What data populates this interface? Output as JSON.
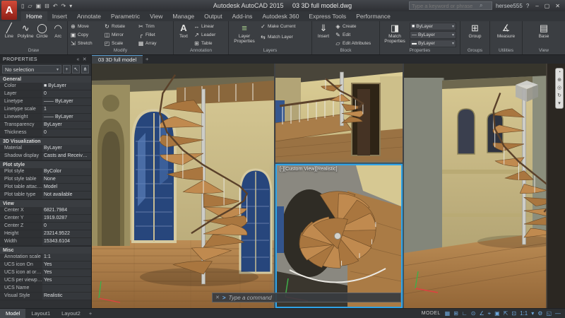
{
  "titlebar": {
    "logo": "A",
    "quick_access": [
      "▯",
      "▱",
      "▣",
      "⊟",
      "↶",
      "↷",
      "▾"
    ],
    "app_title": "Autodesk AutoCAD 2015",
    "doc_title": "03 3D full model.dwg",
    "search_placeholder": "Type a keyword or phrase",
    "search_icon": "⌕",
    "user": "hersee555",
    "help": "?",
    "min": "–",
    "max": "▢",
    "close": "✕"
  },
  "ribbon": {
    "tabs": [
      "Home",
      "Insert",
      "Annotate",
      "Parametric",
      "View",
      "Manage",
      "Output",
      "Add-ins",
      "Autodesk 360",
      "Express Tools",
      "Performance"
    ],
    "panels": {
      "draw": {
        "title": "Draw",
        "items": [
          {
            "icon": "╱",
            "label": "Line"
          },
          {
            "icon": "∿",
            "label": "Polyline"
          },
          {
            "icon": "◯",
            "label": "Circle"
          },
          {
            "icon": "◠",
            "label": "Arc"
          }
        ]
      },
      "modify": {
        "title": "Modify",
        "items": [
          {
            "icon": "⊕",
            "label": "Move"
          },
          {
            "icon": "▣",
            "label": "Copy"
          },
          {
            "icon": "⇲",
            "label": "Stretch"
          },
          {
            "icon": "↻",
            "label": "Rotate"
          },
          {
            "icon": "◫",
            "label": "Mirror"
          },
          {
            "icon": "◰",
            "label": "Scale"
          },
          {
            "icon": "✂",
            "label": "Trim"
          },
          {
            "icon": "╭",
            "label": "Fillet"
          },
          {
            "icon": "▦",
            "label": "Array"
          }
        ]
      },
      "annotation": {
        "title": "Annotation",
        "big": {
          "icon": "A",
          "label": "Text"
        },
        "items": [
          {
            "icon": "↔",
            "label": "Linear"
          },
          {
            "icon": "↗",
            "label": "Leader"
          },
          {
            "icon": "⊞",
            "label": "Table"
          }
        ]
      },
      "layers": {
        "title": "Layers",
        "big": {
          "icon": "≡",
          "label": "Layer Properties"
        },
        "items": [
          {
            "icon": "✓",
            "label": "Make Current"
          },
          {
            "icon": "⇆",
            "label": "Match Layer"
          }
        ]
      },
      "block": {
        "title": "Block",
        "big": {
          "icon": "⇓",
          "label": "Insert"
        },
        "items": [
          {
            "icon": "◈",
            "label": "Create"
          },
          {
            "icon": "✎",
            "label": "Edit"
          },
          {
            "icon": "▱",
            "label": "Edit Attributes"
          }
        ]
      },
      "properties": {
        "title": "Properties",
        "big": {
          "icon": "◨",
          "label": "Match Properties"
        },
        "items": [
          {
            "icon": "■",
            "label": "ByLayer",
            "arrow": "▾"
          },
          {
            "icon": "—",
            "label": "ByLayer",
            "arrow": "▾"
          },
          {
            "icon": "▬",
            "label": "ByLayer",
            "arrow": "▾"
          }
        ]
      },
      "groups": {
        "title": "Groups",
        "big": {
          "icon": "⊞",
          "label": "Group"
        }
      },
      "utilities": {
        "title": "Utilities",
        "big": {
          "icon": "∡",
          "label": "Measure"
        }
      },
      "view": {
        "title": "View",
        "big": {
          "icon": "▤",
          "label": "Base"
        }
      }
    }
  },
  "filetab": {
    "label": "03 3D full model",
    "new_tab": "+"
  },
  "palette": {
    "title": "PROPERTIES",
    "header_icons": [
      "«",
      "✕"
    ],
    "selection": "No selection",
    "combo_arrow": "▾",
    "tool_icons": [
      "+",
      "↖",
      "⋔"
    ],
    "sections": {
      "general": {
        "title": "General",
        "rows": [
          {
            "label": "Color",
            "value": "■ ByLayer"
          },
          {
            "label": "Layer",
            "value": "0"
          },
          {
            "label": "Linetype",
            "value": "—— ByLayer"
          },
          {
            "label": "Linetype scale",
            "value": "1"
          },
          {
            "label": "Lineweight",
            "value": "—— ByLayer"
          },
          {
            "label": "Transparency",
            "value": "ByLayer"
          },
          {
            "label": "Thickness",
            "value": "0"
          }
        ]
      },
      "vis": {
        "title": "3D Visualization",
        "rows": [
          {
            "label": "Material",
            "value": "ByLayer"
          },
          {
            "label": "Shadow display",
            "value": "Casts and Receives S..."
          }
        ]
      },
      "plot": {
        "title": "Plot style",
        "rows": [
          {
            "label": "Plot style",
            "value": "ByColor"
          },
          {
            "label": "Plot style table",
            "value": "None"
          },
          {
            "label": "Plot table attached to",
            "value": "Model"
          },
          {
            "label": "Plot table type",
            "value": "Not available"
          }
        ]
      },
      "view": {
        "title": "View",
        "rows": [
          {
            "label": "Center X",
            "value": "6821.7984"
          },
          {
            "label": "Center Y",
            "value": "1919.0287"
          },
          {
            "label": "Center Z",
            "value": "0"
          },
          {
            "label": "Height",
            "value": "23214.9522"
          },
          {
            "label": "Width",
            "value": "15343.6104"
          }
        ]
      },
      "misc": {
        "title": "Misc",
        "rows": [
          {
            "label": "Annotation scale",
            "value": "1:1"
          },
          {
            "label": "UCS icon On",
            "value": "Yes"
          },
          {
            "label": "UCS icon at origin",
            "value": "Yes"
          },
          {
            "label": "UCS per viewport",
            "value": "Yes"
          },
          {
            "label": "UCS Name",
            "value": ""
          },
          {
            "label": "Visual Style",
            "value": "Realistic"
          }
        ]
      }
    }
  },
  "viewport": {
    "label": "[-][Custom View][Realistic]"
  },
  "navbar": {
    "icons": [
      "◔",
      "⊕",
      "◎",
      "↻",
      "▾"
    ]
  },
  "command": {
    "close": "✕",
    "prompt": ">",
    "placeholder": "Type a command"
  },
  "statusbar": {
    "layout_tabs": [
      "Model",
      "Layout1",
      "Layout2"
    ],
    "new_layout": "+",
    "model_label": "MODEL",
    "icons": [
      "▦",
      "⊞",
      "∟",
      "⊙",
      "∠",
      "⌖",
      "▣",
      "⇱",
      "⊡",
      "1:1",
      "▾",
      "⚙",
      "◱",
      "—"
    ]
  }
}
